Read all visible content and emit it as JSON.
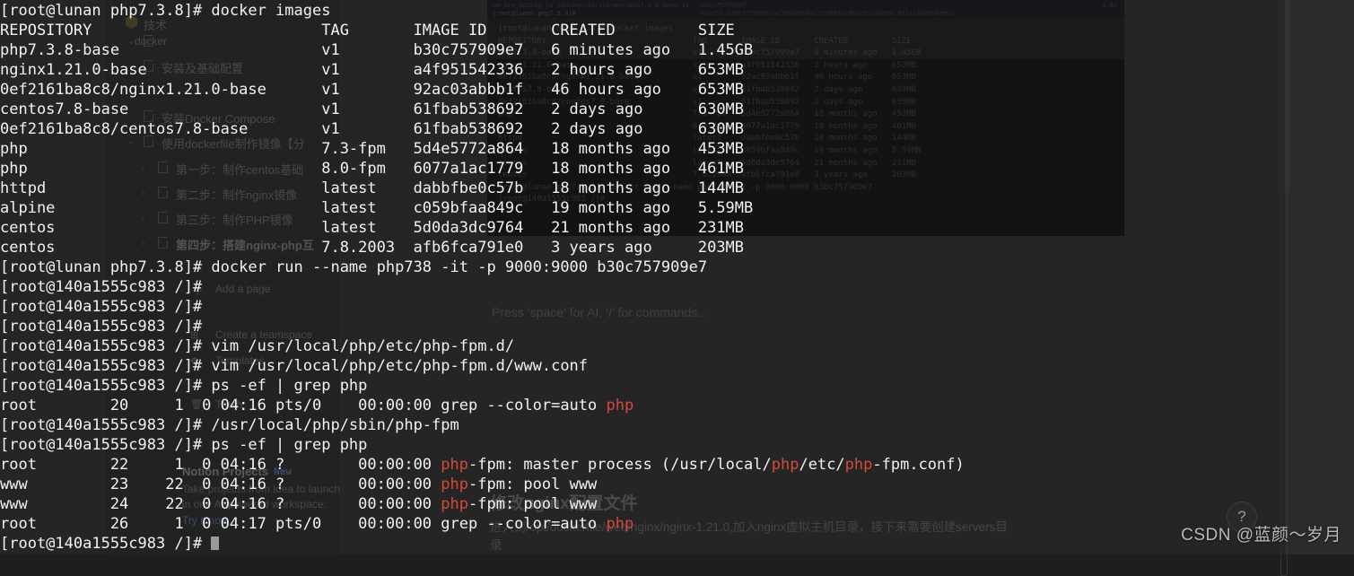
{
  "background_app": {
    "brand_label": "docker",
    "logo_icon": "hexagon-logo-icon",
    "top_item": "技术",
    "sidebar_items": [
      {
        "label": "安装及基础配置",
        "icon": "document-icon",
        "chevron": ""
      },
      {
        "label": "安装Docker Compose",
        "icon": "document-icon",
        "chevron": ""
      },
      {
        "label": "使用dockerfile制作镜像【分",
        "icon": "document-icon",
        "chevron": "⌄"
      },
      {
        "label": "第一步：制作centos基础",
        "icon": "document-icon",
        "chevron": "›"
      },
      {
        "label": "第二步：制作nginx镜像",
        "icon": "document-icon",
        "chevron": "›"
      },
      {
        "label": "第三步：制作PHP镜像",
        "icon": "document-icon",
        "chevron": "›"
      },
      {
        "label": "第四步：搭建nginx-php互",
        "icon": "document-icon",
        "chevron": "›"
      }
    ],
    "lower_sidebar_items": [
      {
        "label": "Add a page",
        "icon": "plus-icon"
      },
      {
        "label": "Create a teamspace",
        "icon": "teamspace-icon"
      },
      {
        "label": "Templates",
        "icon": "templates-icon"
      },
      {
        "label": "Trash",
        "icon": "trash-icon"
      }
    ],
    "promo": {
      "title": "Notion Projects",
      "badge": "New",
      "body": "Take projects from idea to launch in one AI-powered workspace.",
      "link": "Try it now"
    },
    "editor_placeholder": "Press ‘space’ for AI, ‘/’ for commands...",
    "doc_heading": "修改nginx配置文件",
    "doc_paragraph_prefix": "进入到/opt/dockerfile/web/nginx/nginx-1.21.0,加入nginx虚拟主机目录，接下来需要创建servers目",
    "doc_paragraph_suffix": "录"
  },
  "nested_screenshot": {
    "titlebar_left": "we are adding to /docker.io/library/php7.3.8-base:v1",
    "titlebar_prompt": "[root@lunan php7.3.8]#",
    "titlebar_right": "b30c757909e7",
    "titlebar_right2": "sha256:b30c757909e7ac3a50a5b4a1f2e8df0c9bd2b1c48a5e  873a3f6e8e4aeb3",
    "titlebar_pct": "3.8s",
    "lines": [
      "[root@lunan php7.3.8]# docker images",
      "REPOSITORY                              TAG       IMAGE ID       CREATED         SIZE",
      "php7.3.8-base                           v1        b30c757909e7   6 minutes ago   1.45GB",
      "nginx1.21.0-base                        v1        a4f951542336   2 hours ago     653MB",
      "0ef2161ba8c8/nginx1.21.0-base           v1        92ac03abbb1f   46 hours ago    653MB",
      "centos7.8-base                          v1        61fbab538692   2 days ago      630MB",
      "0ef2161ba8c8/centos7.8-base             v1        61fbab538692   2 days ago      630MB",
      "php                                     7.3-fpm   5d4e5772a864   18 months ago   453MB",
      "php                                     8.0-fpm   6077a1ac1779   18 months ago   461MB",
      "httpd                                   latest    dabbfbe0c57b   18 months ago   144MB",
      "alpine                                  latest    c059bfaa849c   19 months ago   5.59MB",
      "centos                                  latest    5d0da3dc9764   21 months ago   231MB",
      "centos                                  7.8.2003  afb6fca791e0   3 years ago     203MB",
      "[root@lunan php7.3.8]# docker run --name php738 -it -p 9000:9000 b30c757909e7",
      "[root@140a1555c983 /]#"
    ]
  },
  "terminal": {
    "lines": [
      {
        "segments": [
          {
            "text": "[root@lunan php7.3.8]# docker images",
            "color": "default"
          }
        ]
      },
      {
        "segments": [
          {
            "text": "REPOSITORY                         TAG       IMAGE ID       CREATED         SIZE",
            "color": "default"
          }
        ]
      },
      {
        "segments": [
          {
            "text": "php7.3.8-base                      v1        b30c757909e7   6 minutes ago   1.45GB",
            "color": "default"
          }
        ]
      },
      {
        "segments": [
          {
            "text": "nginx1.21.0-base                   v1        a4f951542336   2 hours ago     653MB",
            "color": "default"
          }
        ]
      },
      {
        "segments": [
          {
            "text": "0ef2161ba8c8/nginx1.21.0-base      v1        92ac03abbb1f   46 hours ago    653MB",
            "color": "default"
          }
        ]
      },
      {
        "segments": [
          {
            "text": "centos7.8-base                     v1        61fbab538692   2 days ago      630MB",
            "color": "default"
          }
        ]
      },
      {
        "segments": [
          {
            "text": "0ef2161ba8c8/centos7.8-base        v1        61fbab538692   2 days ago      630MB",
            "color": "default"
          }
        ]
      },
      {
        "segments": [
          {
            "text": "php                                7.3-fpm   5d4e5772a864   18 months ago   453MB",
            "color": "default"
          }
        ]
      },
      {
        "segments": [
          {
            "text": "php                                8.0-fpm   6077a1ac1779   18 months ago   461MB",
            "color": "default"
          }
        ]
      },
      {
        "segments": [
          {
            "text": "httpd                              latest    dabbfbe0c57b   18 months ago   144MB",
            "color": "default"
          }
        ]
      },
      {
        "segments": [
          {
            "text": "alpine                             latest    c059bfaa849c   19 months ago   5.59MB",
            "color": "default"
          }
        ]
      },
      {
        "segments": [
          {
            "text": "centos                             latest    5d0da3dc9764   21 months ago   231MB",
            "color": "default"
          }
        ]
      },
      {
        "segments": [
          {
            "text": "centos                             7.8.2003  afb6fca791e0   3 years ago     203MB",
            "color": "default"
          }
        ]
      },
      {
        "segments": [
          {
            "text": "[root@lunan php7.3.8]# docker run --name php738 -it -p 9000:9000 b30c757909e7",
            "color": "default"
          }
        ]
      },
      {
        "segments": [
          {
            "text": "[root@140a1555c983 /]#",
            "color": "default"
          }
        ]
      },
      {
        "segments": [
          {
            "text": "[root@140a1555c983 /]#",
            "color": "default"
          }
        ]
      },
      {
        "segments": [
          {
            "text": "[root@140a1555c983 /]#",
            "color": "default"
          }
        ]
      },
      {
        "segments": [
          {
            "text": "[root@140a1555c983 /]# vim /usr/local/php/etc/php-fpm.d/",
            "color": "default"
          }
        ]
      },
      {
        "segments": [
          {
            "text": "[root@140a1555c983 /]# vim /usr/local/php/etc/php-fpm.d/www.conf",
            "color": "default"
          }
        ]
      },
      {
        "segments": [
          {
            "text": "[root@140a1555c983 /]# ps -ef | grep php",
            "color": "default"
          }
        ]
      },
      {
        "segments": [
          {
            "text": "root        20     1  0 04:16 pts/0    00:00:00 grep --color=auto ",
            "color": "default"
          },
          {
            "text": "php",
            "color": "red"
          }
        ]
      },
      {
        "segments": [
          {
            "text": "[root@140a1555c983 /]# /usr/local/php/sbin/php-fpm",
            "color": "default"
          }
        ]
      },
      {
        "segments": [
          {
            "text": "[root@140a1555c983 /]# ps -ef | grep php",
            "color": "default"
          }
        ]
      },
      {
        "segments": [
          {
            "text": "root        22     1  0 04:16 ?        00:00:00 ",
            "color": "default"
          },
          {
            "text": "php",
            "color": "red"
          },
          {
            "text": "-fpm: master process (/usr/local/",
            "color": "default"
          },
          {
            "text": "php",
            "color": "red"
          },
          {
            "text": "/etc/",
            "color": "default"
          },
          {
            "text": "php",
            "color": "red"
          },
          {
            "text": "-fpm.conf)",
            "color": "default"
          }
        ]
      },
      {
        "segments": [
          {
            "text": "www         23    22  0 04:16 ?        00:00:00 ",
            "color": "default"
          },
          {
            "text": "php",
            "color": "red"
          },
          {
            "text": "-fpm: pool www",
            "color": "default"
          }
        ]
      },
      {
        "segments": [
          {
            "text": "www         24    22  0 04:16 ?        00:00:00 ",
            "color": "default"
          },
          {
            "text": "php",
            "color": "red"
          },
          {
            "text": "-fpm: pool www",
            "color": "default"
          }
        ]
      },
      {
        "segments": [
          {
            "text": "root        26     1  0 04:17 pts/0    00:00:00 grep --color=auto ",
            "color": "default"
          },
          {
            "text": "php",
            "color": "red"
          }
        ]
      },
      {
        "segments": [
          {
            "text": "[root@140a1555c983 /]# ",
            "color": "default"
          },
          {
            "text": "",
            "color": "cursor"
          }
        ]
      }
    ]
  },
  "overlay": {
    "help_label": "?",
    "watermark": "CSDN @蓝颜～岁月"
  },
  "colors": {
    "terminal_bg": "#2b2b2b",
    "terminal_fg": "#f2f2f2",
    "grep_highlight": "#d44a3a",
    "nested_bg": "#0a0a0a",
    "nested_fg": "#3a3a3a",
    "sidebar_bg": "#262626",
    "muted_text": "#6b6b6b",
    "link_blue": "#4d6fa8"
  }
}
